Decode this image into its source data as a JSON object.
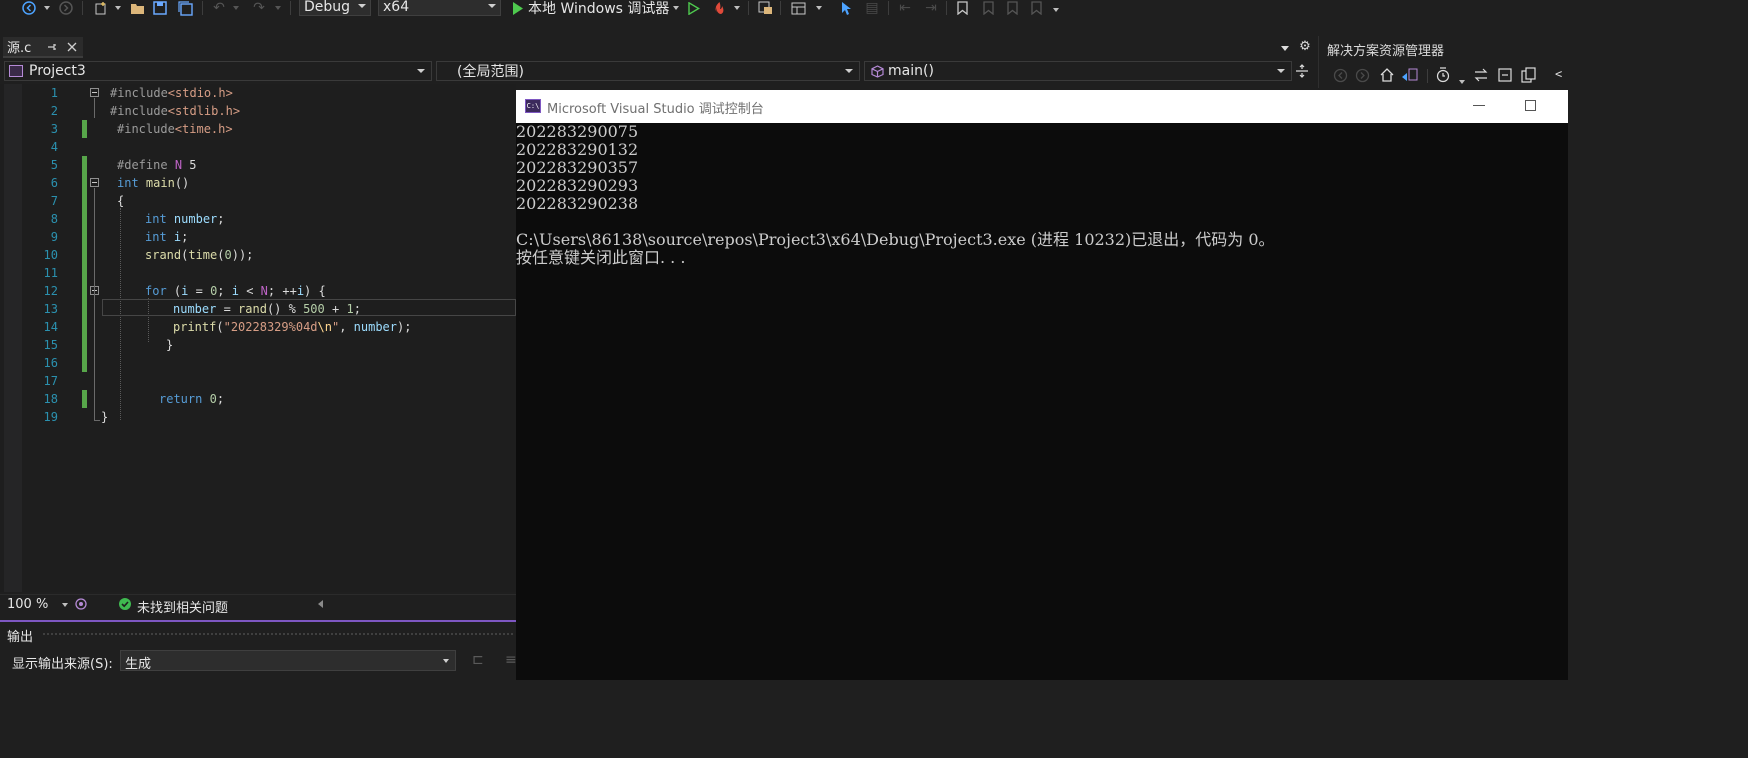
{
  "toolbar": {
    "config": "Debug",
    "platform": "x64",
    "run_label": "本地 Windows 调试器"
  },
  "tab": {
    "file": "源.c"
  },
  "nav": {
    "project": "Project3",
    "scope": "(全局范围)",
    "member": "main()"
  },
  "editor": {
    "zoom": "100 %",
    "issues": "未找到相关问题",
    "line_numbers": [
      "1",
      "2",
      "3",
      "4",
      "5",
      "6",
      "7",
      "8",
      "9",
      "10",
      "11",
      "12",
      "13",
      "14",
      "15",
      "16",
      "17",
      "18",
      "19"
    ],
    "code": {
      "l1_pp": "#include",
      "l1_inc": "<stdio.h>",
      "l2_pp": "#include",
      "l2_inc": "<stdlib.h>",
      "l3_pp": "#include",
      "l3_inc": "<time.h>",
      "l5_pp": "#define",
      "l5_mac": "N",
      "l5_val": "5",
      "l6_kw": "int",
      "l6_fn": "main",
      "l6_rest": "()",
      "l7": "{",
      "l8_kw": "int",
      "l8_var": "number",
      "l8_rest": ";",
      "l9_kw": "int",
      "l9_var": "i",
      "l9_rest": ";",
      "l10_fn": "srand",
      "l10_p1": "(",
      "l10_fn2": "time",
      "l10_p2": "(",
      "l10_num": "0",
      "l10_p3": "));",
      "l12_kw": "for",
      "l12_p1": " (",
      "l12_v1": "i",
      "l12_p2": " = ",
      "l12_n1": "0",
      "l12_p3": "; ",
      "l12_v2": "i",
      "l12_p4": " < ",
      "l12_m": "N",
      "l12_p5": "; ++",
      "l12_v3": "i",
      "l12_p6": ") {",
      "l13_var": "number",
      "l13_p1": " = ",
      "l13_fn": "rand",
      "l13_p2": "() % ",
      "l13_n1": "500",
      "l13_p3": " + ",
      "l13_n2": "1",
      "l13_p4": ";",
      "l14_fn": "printf",
      "l14_p1": "(",
      "l14_s1": "\"20228329%04d",
      "l14_esc": "\\n",
      "l14_s2": "\"",
      "l14_p2": ", ",
      "l14_var": "number",
      "l14_p3": ");",
      "l15": "}",
      "l18_kw": "return",
      "l18_n": "0",
      "l18_p": ";",
      "l19": "}"
    }
  },
  "output": {
    "title": "输出",
    "source_label": "显示输出来源(S):",
    "source_value": "生成"
  },
  "solution_explorer": {
    "title": "解决方案资源管理器"
  },
  "console": {
    "title": "Microsoft Visual Studio 调试控制台",
    "icon_text": "C:\\",
    "lines": [
      "202283290075",
      "202283290132",
      "202283290357",
      "202283290293",
      "202283290238",
      "",
      "C:\\Users\\86138\\source\\repos\\Project3\\x64\\Debug\\Project3.exe (进程 10232)已退出，代码为 0。",
      "按任意键关闭此窗口. . ."
    ]
  },
  "colors": {
    "accent": "#7e57c2",
    "change_bar": "#57a64a",
    "run_green": "#4ec94e",
    "hot_reload": "#e04a3a"
  }
}
